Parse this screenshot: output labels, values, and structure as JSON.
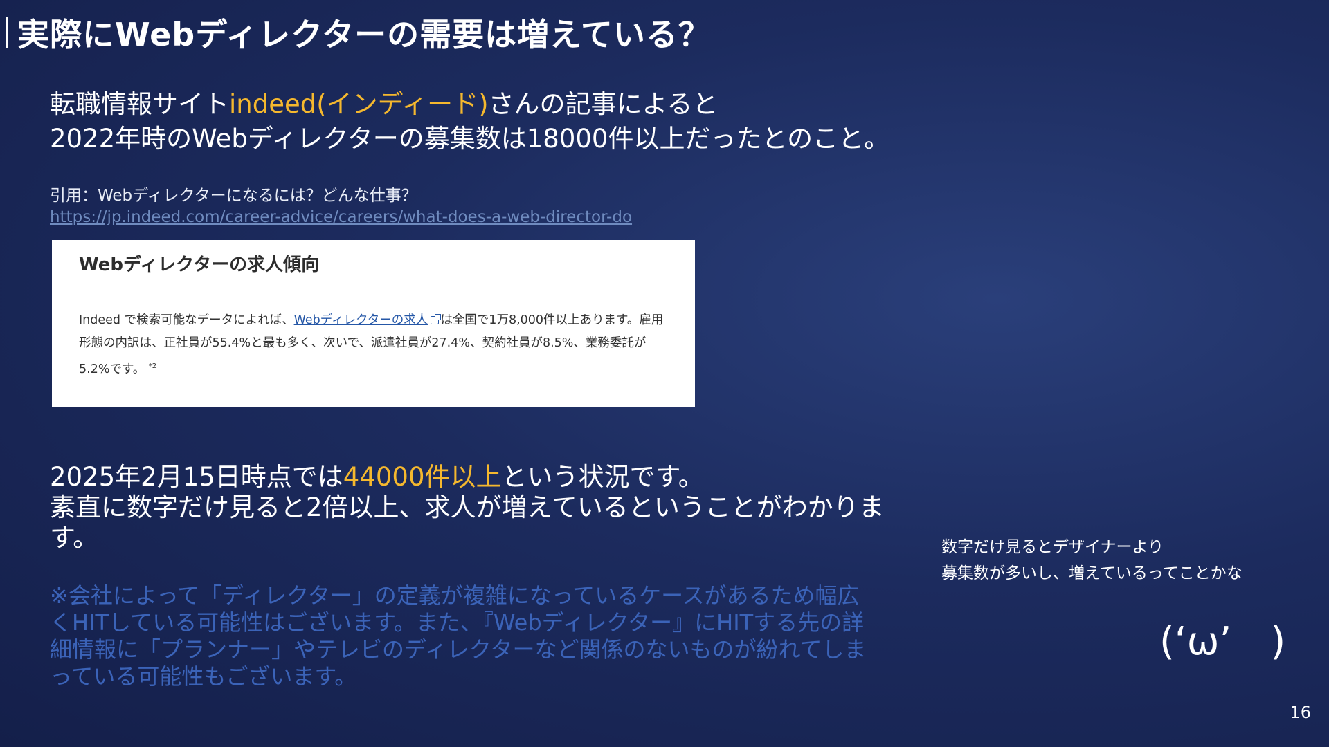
{
  "slide": {
    "title": "実際にWebディレクターの需要は増えている？",
    "lead": {
      "part1": "転職情報サイト",
      "highlight": "indeed(インディード)",
      "part2": "さんの記事によると",
      "line2": "2022年時のWebディレクターの募集数は18000件以上だったとのこと。"
    },
    "citation": {
      "label": "引用：Webディレクターになるには？どんな仕事？",
      "url": "https://jp.indeed.com/career-advice/careers/what-does-a-web-director-do"
    },
    "card": {
      "heading": "Webディレクターの求人傾向",
      "text_before_link": "Indeed で検索可能なデータによれば、",
      "link_text": "Webディレクターの求人",
      "text_after_link": "は全国で1万8,000件以上あります。雇用形態の内訳は、正社員が55.4%と最も多く、次いで、派遣社員が27.4%、契約社員が8.5%、業務委託が5.2%です。",
      "footnote": "*2"
    },
    "status": {
      "part1": "2025年2月15日時点では",
      "highlight": "44000件以上",
      "part2": "という状況です。",
      "line2": "素直に数字だけ見ると2倍以上、求人が増えているということがわかります。"
    },
    "note": "※会社によって「ディレクター」の定義が複雑になっているケースがあるため幅広くHITしている可能性はございます。また、『Webディレクター』にHITする先の詳細情報に「プランナー」やテレビのディレクターなど関係のないものが紛れてしまっている可能性もございます。",
    "side_comment": {
      "line1": "数字だけ見るとデザイナーより",
      "line2": "募集数が多いし、増えているってことかな"
    },
    "face": "(‘ω’　)",
    "page_number": "16"
  },
  "colors": {
    "background": "#1c2b5e",
    "highlight": "#f5b82e",
    "note": "#3b63b8",
    "link": "#6f8bbf",
    "card_link": "#2557a7"
  }
}
